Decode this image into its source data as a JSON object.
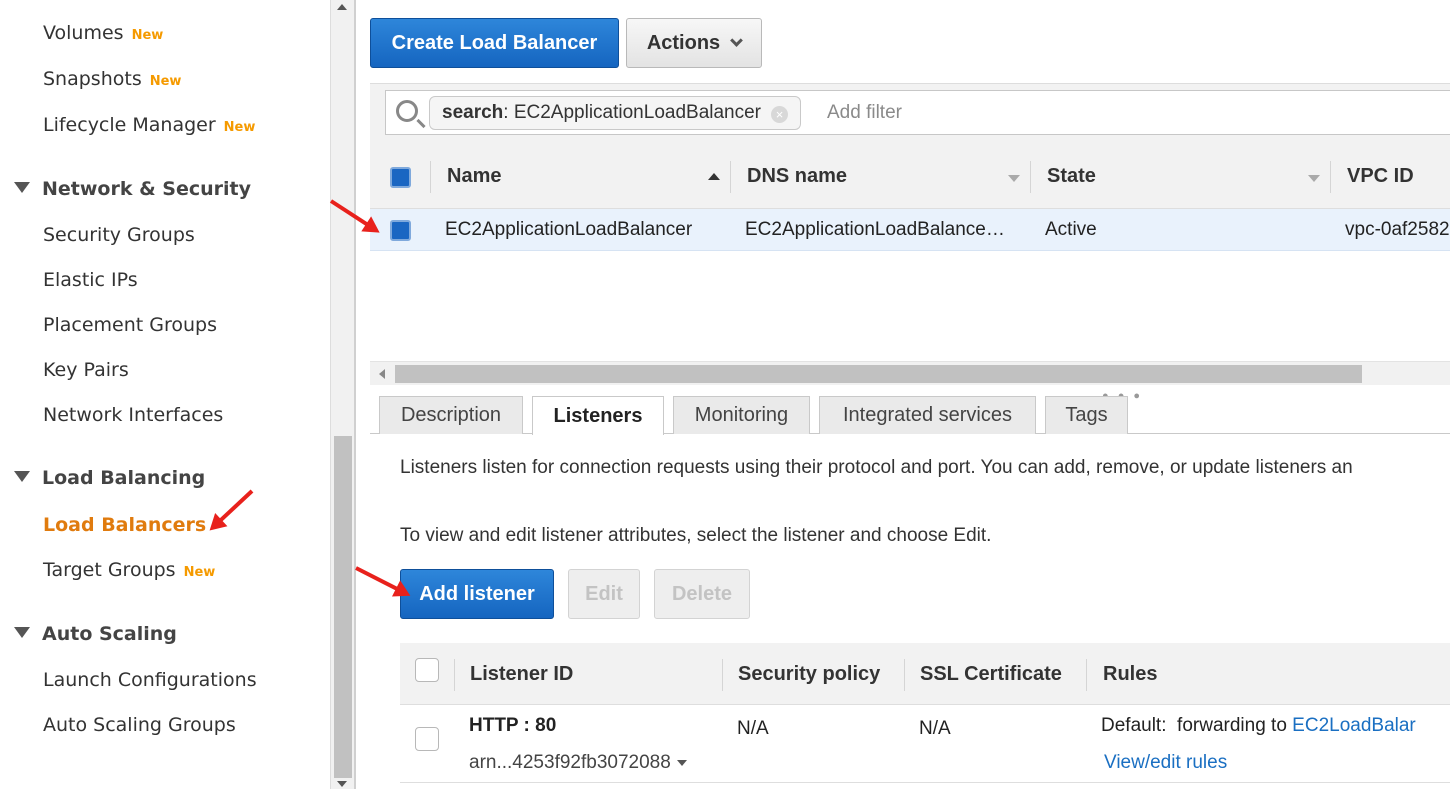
{
  "sidebar": {
    "items": [
      {
        "label": "Volumes",
        "badge": "New"
      },
      {
        "label": "Snapshots",
        "badge": "New"
      },
      {
        "label": "Lifecycle Manager",
        "badge": "New"
      }
    ],
    "sections": [
      {
        "title": "Network & Security",
        "items": [
          "Security Groups",
          "Elastic IPs",
          "Placement Groups",
          "Key Pairs",
          "Network Interfaces"
        ]
      },
      {
        "title": "Load Balancing",
        "items": [
          "Load Balancers",
          "Target Groups"
        ],
        "active": "Load Balancers",
        "badge": "New"
      },
      {
        "title": "Auto Scaling",
        "items": [
          "Launch Configurations",
          "Auto Scaling Groups"
        ]
      }
    ]
  },
  "toolbar": {
    "create_label": "Create Load Balancer",
    "actions_label": "Actions"
  },
  "filter": {
    "token_key": "search",
    "token_value": ": EC2ApplicationLoadBalancer",
    "placeholder": "Add filter"
  },
  "table": {
    "columns": [
      "Name",
      "DNS name",
      "State",
      "VPC ID"
    ],
    "rows": [
      {
        "name": "EC2ApplicationLoadBalancer",
        "dns": "EC2ApplicationLoadBalance…",
        "state": "Active",
        "vpc": "vpc-0af2582"
      }
    ]
  },
  "tabs": [
    "Description",
    "Listeners",
    "Monitoring",
    "Integrated services",
    "Tags"
  ],
  "active_tab": "Listeners",
  "listeners": {
    "intro": "Listeners listen for connection requests using their protocol and port. You can add, remove, or update listeners an",
    "hint": "To view and edit listener attributes, select the listener and choose Edit.",
    "add_label": "Add listener",
    "edit_label": "Edit",
    "delete_label": "Delete",
    "columns": [
      "Listener ID",
      "Security policy",
      "SSL Certificate",
      "Rules"
    ],
    "row": {
      "protocol": "HTTP : 80",
      "arn": "arn...4253f92fb3072088",
      "security_policy": "N/A",
      "ssl_certificate": "N/A",
      "rules_default": "Default:",
      "rules_action": "forwarding to",
      "rules_target": "EC2LoadBalar",
      "rules_link": "View/edit rules"
    }
  },
  "colors": {
    "primary_button": "#1a66c2",
    "active_nav": "#e07b0e",
    "badge": "#f59a00",
    "annotation_arrow": "#e8211c",
    "link": "#1a6fc2"
  }
}
